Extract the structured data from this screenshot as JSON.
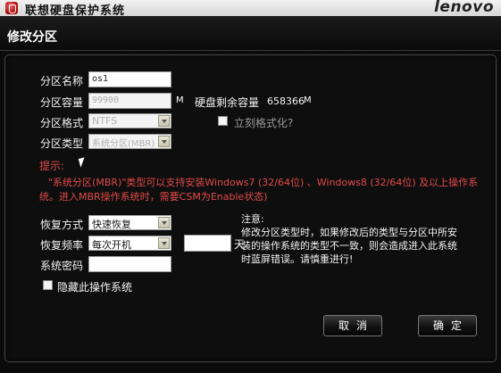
{
  "window": {
    "title": "联想硬盘保护系统",
    "brand": "lenovo"
  },
  "header": {
    "title": "修改分区"
  },
  "form": {
    "name_label": "分区名称",
    "name_value": "os1",
    "size_label": "分区容量",
    "size_value": "99900",
    "size_unit": "M",
    "remaining_label": "硬盘剩余容量",
    "remaining_value": "658366",
    "remaining_unit": "M",
    "format_label": "分区格式",
    "format_value": "NTFS",
    "quick_format_label": "立刻格式化?",
    "type_label": "分区类型",
    "type_value": "系统分区(MBR)"
  },
  "hint": {
    "title": "提示:",
    "text": "\"系统分区(MBR)\"类型可以支持安装Windows7 (32/64位) 、Windows8 (32/64位) 及以上操作系统。进入MBR操作系统时，需要CSM为Enable状态)"
  },
  "restore": {
    "mode_label": "恢复方式",
    "mode_value": "快速恢复",
    "freq_label": "恢复频率",
    "freq_value": "每次开机",
    "days_value": "",
    "days_unit": "天",
    "password_label": "系统密码",
    "password_value": "",
    "hide_os_label": "隐藏此操作系统"
  },
  "note": {
    "title": "注意:",
    "text": "修改分区类型时，如果修改后的类型与分区中所安装的操作系统的类型不一致，则会造成进入此系统时蓝屏错误。请慎重进行!"
  },
  "buttons": {
    "cancel": "取消",
    "ok": "确定"
  }
}
